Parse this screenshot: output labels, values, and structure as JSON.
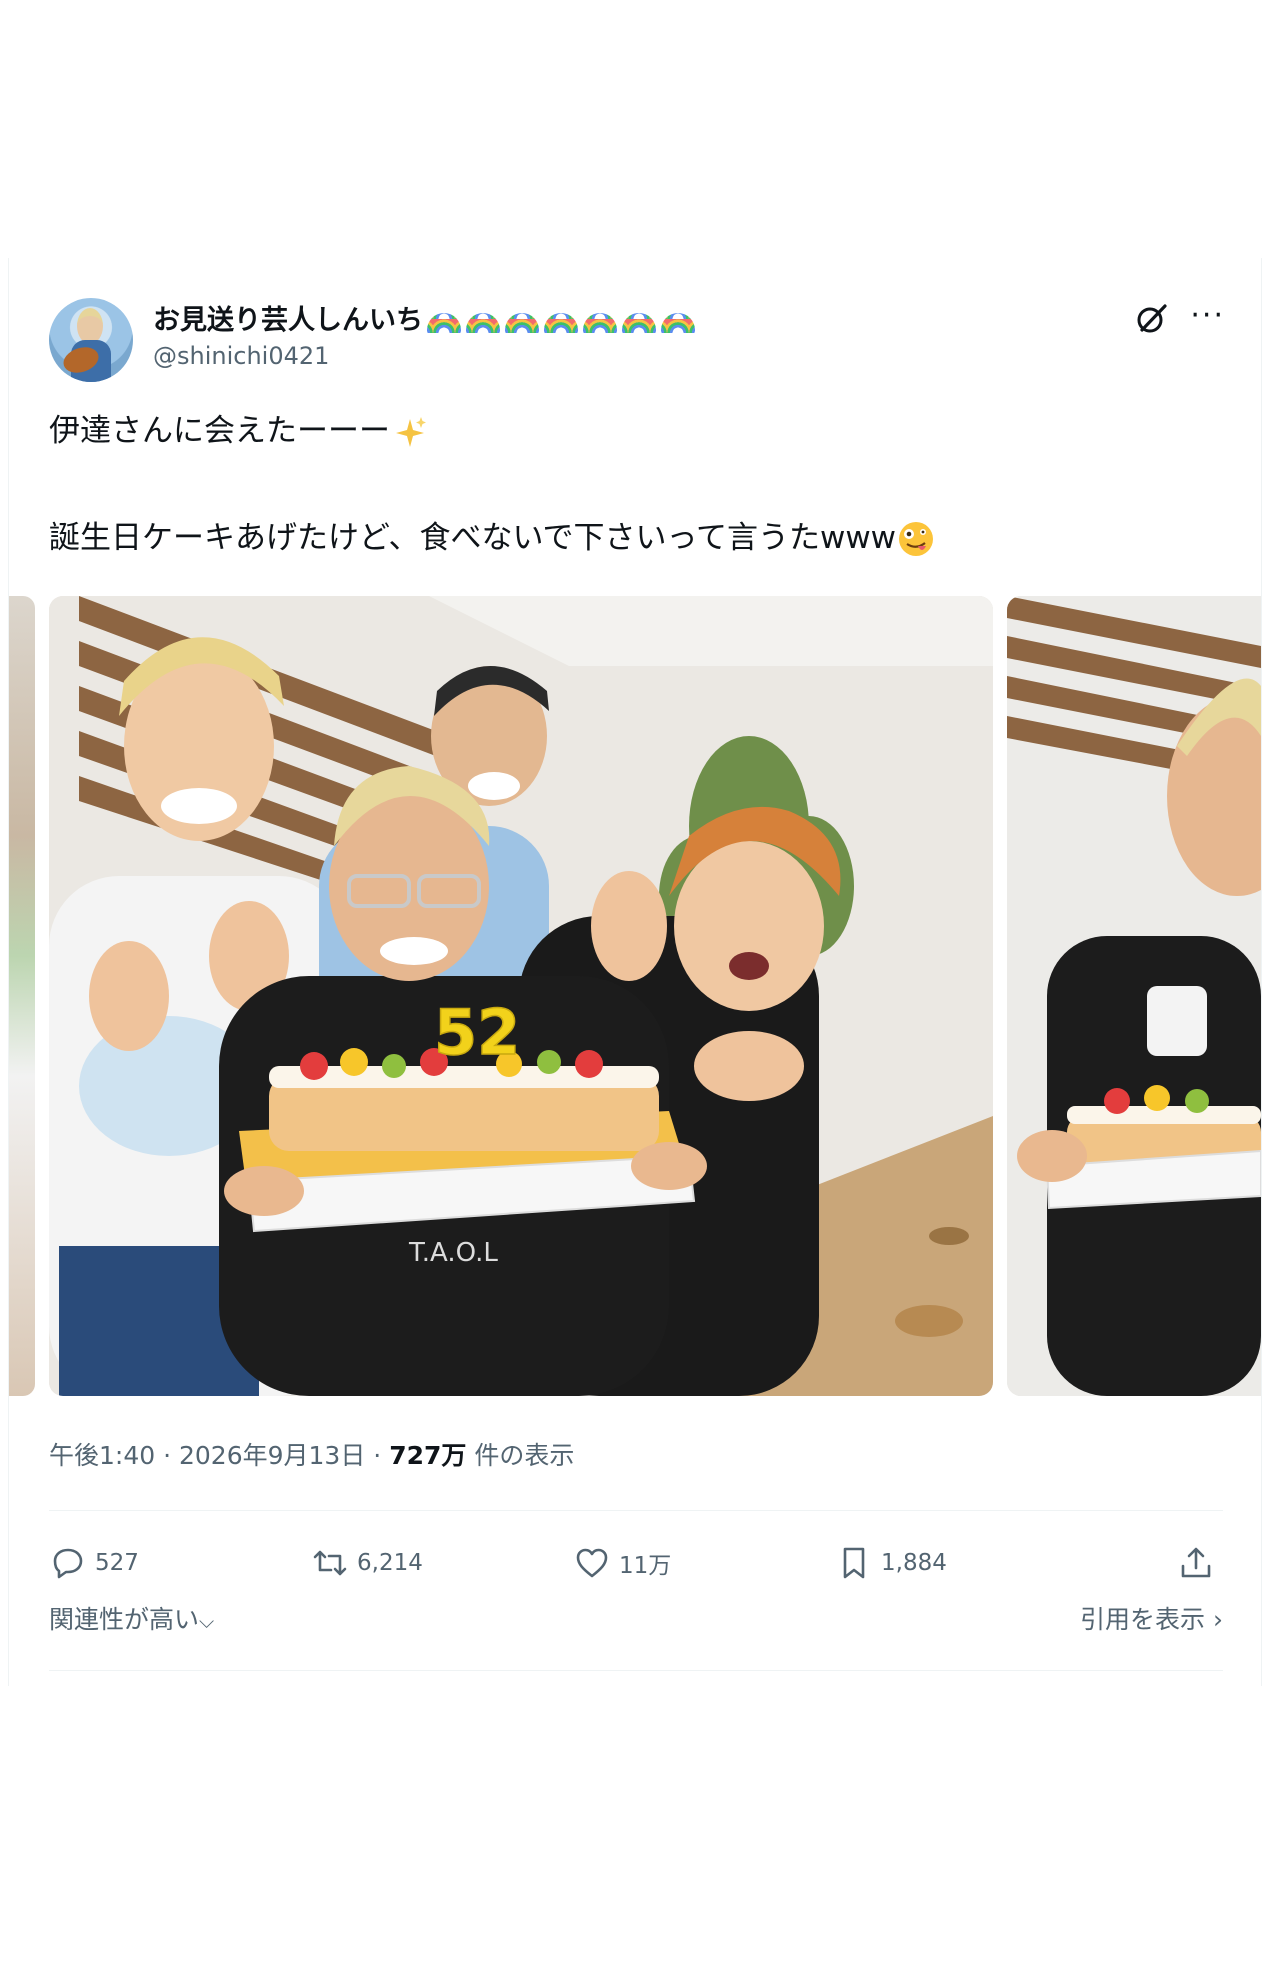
{
  "author": {
    "display_name": "お見送り芸人しんいち",
    "handle": "@shinichi0421",
    "name_emoji": [
      "rainbow-icon",
      "rainbow-icon",
      "rainbow-icon",
      "rainbow-icon",
      "rainbow-icon",
      "rainbow-icon",
      "rainbow-icon"
    ]
  },
  "tweet": {
    "line1": "伊達さんに会えたーーー",
    "line2": "誕生日ケーキあげたけど、食べないで下さいって言うたwww"
  },
  "media": {
    "candle_digits": "52",
    "apron_text": "T.A.O.L"
  },
  "meta": {
    "time": "午後1:40",
    "sep": "·",
    "date": "2026年9月13日",
    "views_count": "727万",
    "views_label": "件の表示"
  },
  "actions": {
    "replies": "527",
    "reposts": "6,214",
    "likes": "11万",
    "bookmarks": "1,884"
  },
  "footer": {
    "sort_label": "関連性が高い",
    "quotes_label": "引用を表示"
  },
  "colors": {
    "text": "#0f1419",
    "secondary": "#536471",
    "divider": "#eff3f4"
  }
}
